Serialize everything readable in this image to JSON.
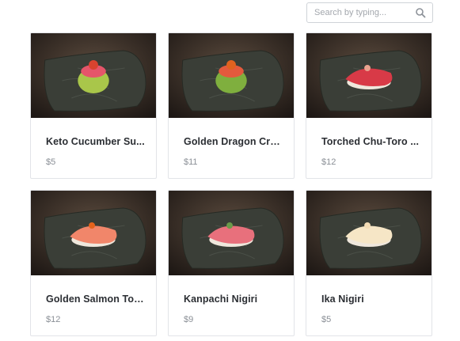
{
  "search": {
    "placeholder": "Search by typing..."
  },
  "items": [
    {
      "title": "Keto Cucumber Su...",
      "price": "$5",
      "fish": "#e5556a",
      "base": "#a9c64a",
      "topping": "#d9432f"
    },
    {
      "title": "Golden Dragon Cre...",
      "price": "$11",
      "fish": "#e35a3d",
      "base": "#7faf3e",
      "topping": "#e0621f"
    },
    {
      "title": "Torched Chu-Toro ...",
      "price": "$12",
      "fish": "#d83a47",
      "base": "#efe7dc",
      "topping": "#e9a38f"
    },
    {
      "title": "Golden Salmon Tor...",
      "price": "$12",
      "fish": "#f1866a",
      "base": "#efe7dc",
      "topping": "#e5631c"
    },
    {
      "title": "Kanpachi Nigiri",
      "price": "$9",
      "fish": "#e8707c",
      "base": "#efe7dc",
      "topping": "#6a9a4a"
    },
    {
      "title": "Ika Nigiri",
      "price": "$5",
      "fish": "#f6e6c6",
      "base": "#efe7dc",
      "topping": "#f3dcb5"
    }
  ]
}
